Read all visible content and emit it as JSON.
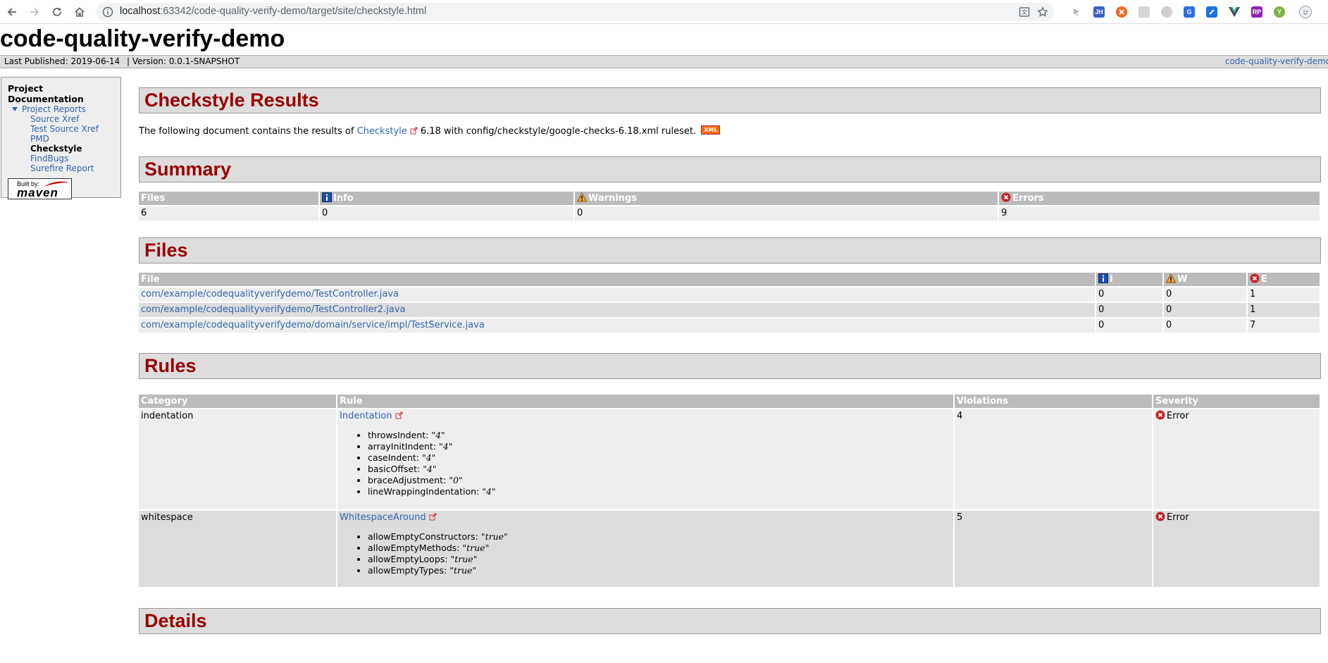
{
  "browser": {
    "url_host": "localhost",
    "url_rest": ":63342/code-quality-verify-demo/target/site/checkstyle.html",
    "extensions": [
      {
        "name": "cursor-ext-icon",
        "label": "",
        "color": "#c0c4cc"
      },
      {
        "name": "jh-ext-icon",
        "label": "JH",
        "color": "#3b5fc8"
      },
      {
        "name": "orange-ext-icon",
        "label": "",
        "color": "#f26522"
      },
      {
        "name": "grey-ext-icon",
        "label": "",
        "color": "#d6d6d6"
      },
      {
        "name": "cat-ext-icon",
        "label": "",
        "color": "#cfcfcf"
      },
      {
        "name": "translate-ext-icon",
        "label": "",
        "color": "#2a6ee8"
      },
      {
        "name": "blue-square-ext-icon",
        "label": "",
        "color": "#1a73e8"
      },
      {
        "name": "vue-ext-icon",
        "label": "",
        "color": "#35495e"
      },
      {
        "name": "rp-ext-icon",
        "label": "RP",
        "color": "#8e24aa"
      },
      {
        "name": "y-ext-icon",
        "label": "Y",
        "color": "#7cb342"
      }
    ]
  },
  "site": {
    "title": "code-quality-verify-demo",
    "last_published": "Last Published: 2019-06-14",
    "version": "| Version: 0.0.1-SNAPSHOT",
    "breadcrumb_right": "code-quality-verify-demo"
  },
  "nav": {
    "heading": "Project Documentation",
    "group_label": "Project Reports",
    "items": [
      "Source Xref",
      "Test Source Xref",
      "PMD",
      "Checkstyle",
      "FindBugs",
      "Surefire Report"
    ],
    "built_by": "Built by:",
    "maven": "maven"
  },
  "results": {
    "heading": "Checkstyle Results",
    "intro_before": "The following document contains the results of ",
    "intro_link": "Checkstyle",
    "intro_after": " 6.18 with config/checkstyle/google-checks-6.18.xml ruleset.",
    "xml_badge": "XML"
  },
  "summary": {
    "heading": "Summary",
    "headers": [
      "Files",
      "Info",
      "Warnings",
      "Errors"
    ],
    "values": [
      "6",
      "0",
      "0",
      "9"
    ]
  },
  "files": {
    "heading": "Files",
    "headers": [
      "File",
      "I",
      "W",
      "E"
    ],
    "rows": [
      [
        "com/example/codequalityverifydemo/TestController.java",
        "0",
        "0",
        "1"
      ],
      [
        "com/example/codequalityverifydemo/TestController2.java",
        "0",
        "0",
        "1"
      ],
      [
        "com/example/codequalityverifydemo/domain/service/impl/TestService.java",
        "0",
        "0",
        "7"
      ]
    ]
  },
  "rules": {
    "heading": "Rules",
    "headers": [
      "Category",
      "Rule",
      "Violations",
      "Severity"
    ],
    "rows": [
      {
        "category": "indentation",
        "rule": "Indentation",
        "props": [
          [
            "throwsIndent: ",
            "\"4\""
          ],
          [
            "arrayInitIndent: ",
            "\"4\""
          ],
          [
            "caseIndent: ",
            "\"4\""
          ],
          [
            "basicOffset: ",
            "\"4\""
          ],
          [
            "braceAdjustment: ",
            "\"0\""
          ],
          [
            "lineWrappingIndentation: ",
            "\"4\""
          ]
        ],
        "violations": "4",
        "severity": "Error"
      },
      {
        "category": "whitespace",
        "rule": "WhitespaceAround",
        "props": [
          [
            "allowEmptyConstructors: ",
            "\"true\""
          ],
          [
            "allowEmptyMethods: ",
            "\"true\""
          ],
          [
            "allowEmptyLoops: ",
            "\"true\""
          ],
          [
            "allowEmptyTypes: ",
            "\"true\""
          ]
        ],
        "violations": "5",
        "severity": "Error"
      }
    ]
  },
  "details": {
    "heading": "Details"
  }
}
